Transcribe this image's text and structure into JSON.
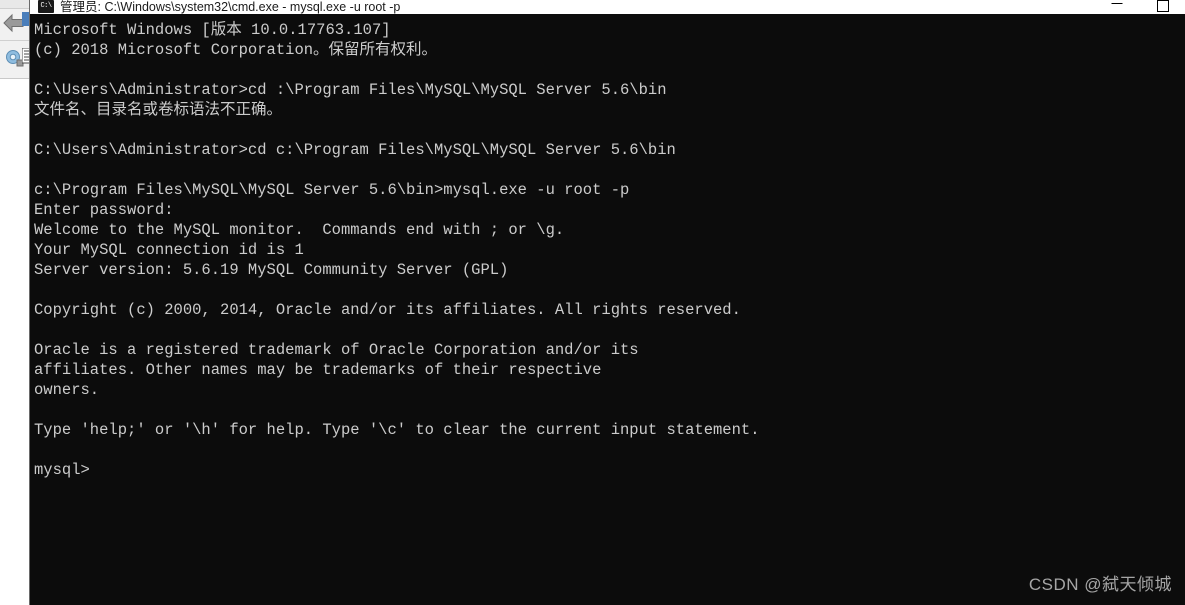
{
  "background_app": {
    "name": "background-window",
    "icons": [
      {
        "name": "back-arrow-icon",
        "label": "back"
      },
      {
        "name": "gear-icon",
        "label": "settings"
      },
      {
        "name": "list-icon",
        "label": "list"
      }
    ]
  },
  "window": {
    "title": "管理员: C:\\Windows\\system32\\cmd.exe - mysql.exe  -u root -p",
    "icon_glyph": "C:\\",
    "controls": {
      "minimize_label": "Minimize",
      "maximize_label": "Maximize"
    },
    "background_color": "#0c0c0c",
    "text_color": "#cccccc"
  },
  "console": {
    "lines": [
      "Microsoft Windows [版本 10.0.17763.107]",
      "(c) 2018 Microsoft Corporation。保留所有权利。",
      "",
      "C:\\Users\\Administrator>cd :\\Program Files\\MySQL\\MySQL Server 5.6\\bin",
      "文件名、目录名或卷标语法不正确。",
      "",
      "C:\\Users\\Administrator>cd c:\\Program Files\\MySQL\\MySQL Server 5.6\\bin",
      "",
      "c:\\Program Files\\MySQL\\MySQL Server 5.6\\bin>mysql.exe -u root -p",
      "Enter password:",
      "Welcome to the MySQL monitor.  Commands end with ; or \\g.",
      "Your MySQL connection id is 1",
      "Server version: 5.6.19 MySQL Community Server (GPL)",
      "",
      "Copyright (c) 2000, 2014, Oracle and/or its affiliates. All rights reserved.",
      "",
      "Oracle is a registered trademark of Oracle Corporation and/or its",
      "affiliates. Other names may be trademarks of their respective",
      "owners.",
      "",
      "Type 'help;' or '\\h' for help. Type '\\c' to clear the current input statement.",
      "",
      "mysql>"
    ]
  },
  "watermark": {
    "text": "CSDN @弑天倾城",
    "color": "#a6a6a6"
  }
}
